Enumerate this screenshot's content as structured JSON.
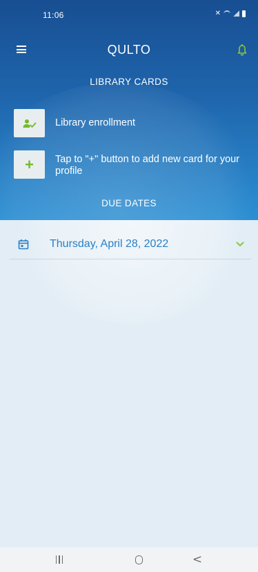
{
  "status_bar": {
    "time": "11:06",
    "icons": [
      "mute-icon",
      "wifi-icon",
      "signal-icon",
      "battery-icon"
    ]
  },
  "app_bar": {
    "title": "QULTO",
    "left_icon": "menu-icon",
    "right_icon": "bell-icon"
  },
  "library_cards": {
    "title": "LIBRARY CARDS",
    "items": [
      {
        "icon": "person-check-icon",
        "label": "Library enrollment"
      },
      {
        "icon": "plus-icon",
        "label": "Tap to \"+\" button to add new card for your profile",
        "icon_text": "+"
      }
    ]
  },
  "due_dates": {
    "title": "DUE DATES",
    "items": [
      {
        "icon": "calendar-icon",
        "date": "Thursday, April 28, 2022",
        "expand_icon": "chevron-down-icon"
      }
    ]
  },
  "nav_bar": {
    "buttons": [
      "recents-icon",
      "home-icon",
      "back-icon"
    ]
  },
  "colors": {
    "header_top": "#184e92",
    "header_bottom": "#2c8fd3",
    "accent_green": "#76b928",
    "date_blue": "#2a7fc5",
    "content_bg": "#e2edf5"
  }
}
